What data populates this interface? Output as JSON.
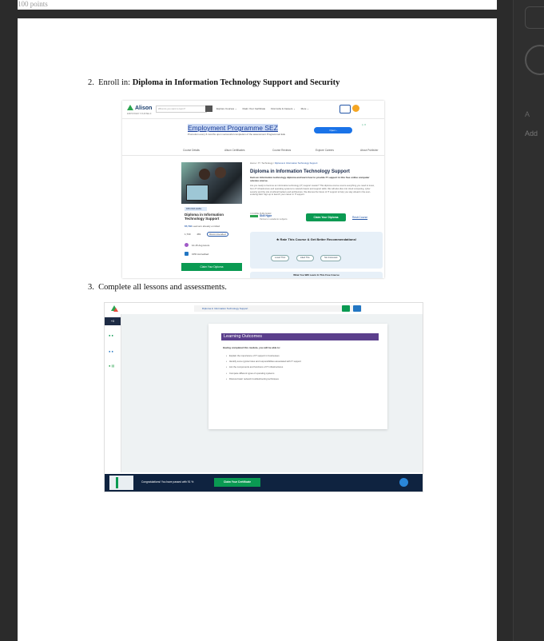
{
  "previous_page": {
    "fragment_text": "100 points"
  },
  "steps": [
    {
      "number": "2.",
      "text": "Enroll in: ",
      "bold": "Diploma in Information Technology Support and Security"
    },
    {
      "number": "3.",
      "text": "Complete all lessons and assessments.",
      "bold": ""
    }
  ],
  "right_panel": {
    "text_1": "A",
    "text_2": "Add"
  },
  "screenshot_enroll": {
    "brand": "Alison",
    "tagline": "EMPOWER YOURSELF",
    "search_placeholder": "What do you want to learn?",
    "nav_links": [
      "Explore Courses ⌄",
      "Claim Your Certificate",
      "Find Jobs & Careers ⌄",
      "More ⌄"
    ],
    "ad": {
      "title": "Employment Programme SEZ",
      "subtitle": "Promotion every 6 months upon successful completion of the assessment Programmed Edu",
      "button": "Open ›",
      "badge": "▷ X"
    },
    "tabs": [
      "Course Details",
      "Alison Certificates",
      "Course Reviews",
      "Explore Careers",
      "About Publisher"
    ],
    "chip": "DIPLOMA LEVEL",
    "course_title_short": "Diploma in Information Technology Support",
    "enrolled_count": "67,794",
    "enrolled_text": "Learners already enrolled",
    "stats": [
      "1,730",
      "481",
      "Recommended"
    ],
    "features": [
      "10-15 Avg Hours",
      "CPD Accredited"
    ],
    "claim_left": "Claim Your Diploma",
    "breadcrumb_prefix": "Home / IT / Technology / ",
    "breadcrumb_current": "Diploma in Information Technology Support",
    "heading": "Diploma in Information Technology Support",
    "intro": "Gain an information technology diploma and learn how to provide IT support in this free online computer science course.",
    "description": "Are you ready to become an information technology (IT) support master? This diploma course covers everything you need to know, from IT infrastructure and operating systems to network basics and support skills. We will also dive into cloud computing, cyber security and the role of ethical hackers and architecture. We discuss the future of IT support to help you stay ahead in the ever-evolving field. Sign up to launch your career in IT support.",
    "publisher_label": "COURSE PUBLISHER",
    "publisher_name": "Skill Hype",
    "publisher_sub": "Partners in academic subjects",
    "claim_button": "Claim Your Diploma",
    "resit_link": "Resit Course",
    "rate_title": "★ Rate This Course & Get Better Recommendations!",
    "rate_buttons": [
      "Loved This!",
      "Liked This",
      "Not Interested"
    ],
    "cutoff_text": "What You Will Learn In This Free Course"
  },
  "screenshot_lesson": {
    "tab_title": "Diploma in Information Technology Support",
    "sidebar_head": "+0",
    "sidebar_dots": [
      "● ●",
      "● ●",
      "● ▤"
    ],
    "card_title": "Learning Outcomes",
    "card_intro": "Having completed this module, you will be able to:",
    "outcomes": [
      "Explain the importance of IT support in businesses",
      "Identify some typical roles and responsibilities associated with IT support",
      "List the components and functions of IT infrastructures",
      "Compare different types of operating systems",
      "Discuss basic network troubleshooting techniques"
    ],
    "congrats": "Congratulations! You have passed with 91 %",
    "certificate_button": "Claim Your Certificate"
  }
}
